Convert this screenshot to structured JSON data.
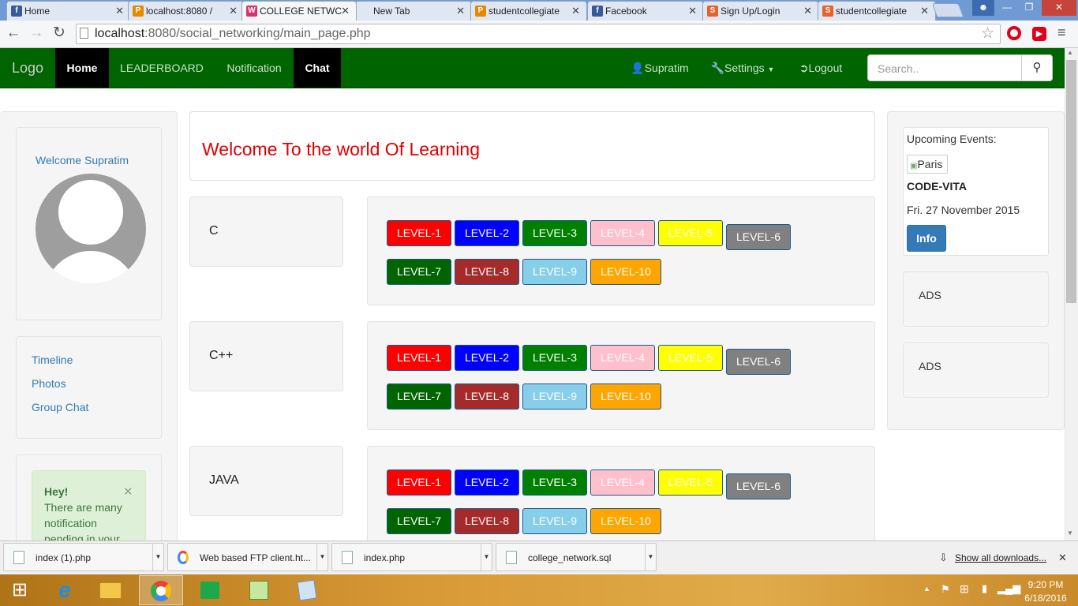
{
  "browser": {
    "tabs": [
      {
        "label": "Home",
        "favicon": "facebook-icon",
        "fav_color": "#3b5998",
        "fav_char": "f"
      },
      {
        "label": "localhost:8080 / ",
        "favicon": "phpmyadmin-icon",
        "fav_color": "#e58a00",
        "fav_char": "P"
      },
      {
        "label": "COLLEGE NETWC",
        "favicon": "wamp-icon",
        "fav_color": "#d6336c",
        "fav_char": "W"
      },
      {
        "label": "New Tab",
        "favicon": "",
        "fav_color": "",
        "fav_char": ""
      },
      {
        "label": "studentcollegiate",
        "favicon": "phpmyadmin-icon",
        "fav_color": "#e58a00",
        "fav_char": "P"
      },
      {
        "label": "Facebook",
        "favicon": "facebook-icon",
        "fav_color": "#3b5998",
        "fav_char": "f"
      },
      {
        "label": "Sign Up/Login",
        "favicon": "app-icon",
        "fav_color": "#e8602c",
        "fav_char": "S"
      },
      {
        "label": "studentcollegiate",
        "favicon": "app-icon",
        "fav_color": "#e8602c",
        "fav_char": "S"
      }
    ],
    "tab_close": "✕",
    "url_host": "localhost",
    "url_rest": ":8080/social_networking/main_page.php"
  },
  "navbar": {
    "logo": "Logo",
    "items": [
      "Home",
      "LEADERBOARD",
      "Notification",
      "Chat"
    ],
    "user": "Supratim",
    "settings": "Settings",
    "logout": "Logout",
    "search_placeholder": "Search.."
  },
  "left": {
    "welcome": "Welcome Supratim",
    "links": [
      "Timeline",
      "Photos",
      "Group Chat"
    ],
    "alert_title": "Hey!",
    "alert_text": "There are many notification pending in your"
  },
  "main": {
    "welcome_title": "Welcome To the world Of Learning",
    "subjects": [
      {
        "name": "C"
      },
      {
        "name": "C++"
      },
      {
        "name": "JAVA"
      }
    ],
    "levels": [
      {
        "label": "LEVEL-1",
        "color": "#ff0000",
        "text": "#ffffff"
      },
      {
        "label": "LEVEL-2",
        "color": "#0000ff",
        "text": "#ffffff"
      },
      {
        "label": "LEVEL-3",
        "color": "#008000",
        "text": "#ffffff"
      },
      {
        "label": "LEVEL-4",
        "color": "#ffc0cb",
        "text": "#ffffff"
      },
      {
        "label": "LEVEL-5",
        "color": "#ffff00",
        "text": "#ffffff"
      },
      {
        "label": "LEVEL-6",
        "color": "#808080",
        "text": "#ffffff"
      },
      {
        "label": "LEVEL-7",
        "color": "#006400",
        "text": "#ffffff"
      },
      {
        "label": "LEVEL-8",
        "color": "#a52a2a",
        "text": "#ffffff"
      },
      {
        "label": "LEVEL-9",
        "color": "#87ceeb",
        "text": "#ffffff"
      },
      {
        "label": "LEVEL-10",
        "color": "#ffa500",
        "text": "#ffffff"
      }
    ]
  },
  "right": {
    "events_title": "Upcoming Events:",
    "event_img_alt": "Paris",
    "event_name": "CODE-VITA",
    "event_date": "Fri. 27 November 2015",
    "info_button": "Info",
    "ads": [
      "ADS",
      "ADS"
    ]
  },
  "downloads": {
    "items": [
      "index (1).php",
      "Web based FTP client.ht...",
      "index.php",
      "college_network.sql"
    ],
    "show_all": "Show all downloads...",
    "close": "✕"
  },
  "taskbar": {
    "time": "9:20 PM",
    "date": "6/18/2016"
  },
  "colors": {
    "navbar": "#006400",
    "accent": "#337ab7",
    "welcome_red": "#e00000"
  }
}
